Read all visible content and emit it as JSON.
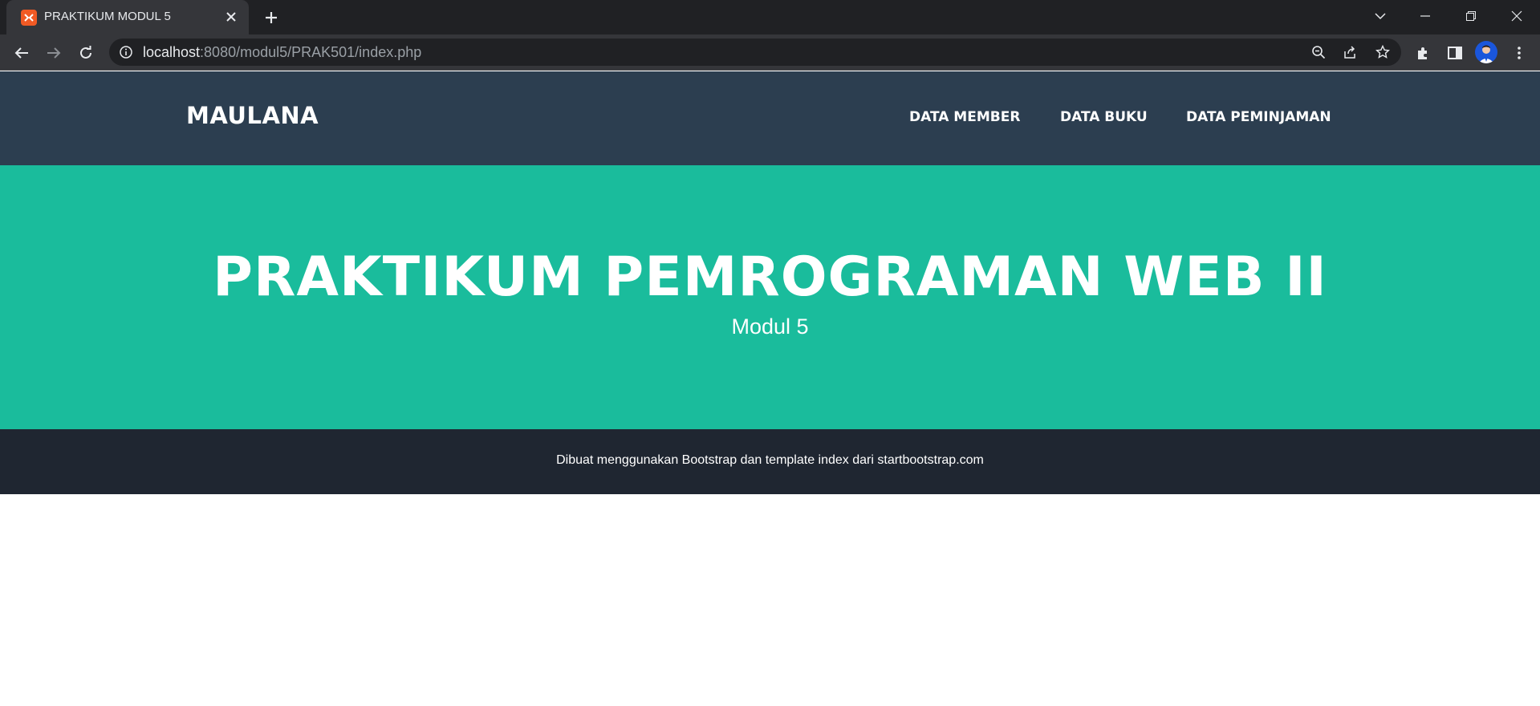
{
  "browser": {
    "tab_title": "PRAKTIKUM MODUL 5",
    "url_host": "localhost",
    "url_path": ":8080/modul5/PRAK501/index.php"
  },
  "navbar": {
    "brand": "MAULANA",
    "links": [
      "DATA MEMBER",
      "DATA BUKU",
      "DATA PEMINJAMAN"
    ]
  },
  "hero": {
    "title": "PRAKTIKUM PEMROGRAMAN WEB II",
    "subtitle": "Modul 5"
  },
  "footer": {
    "text": "Dibuat menggunakan Bootstrap dan template index dari startbootstrap.com"
  },
  "colors": {
    "navbar_bg": "#2c3e50",
    "hero_bg": "#1abc9c",
    "footer_bg": "#1f2631",
    "chrome_dark": "#202124",
    "chrome_tab": "#35363a"
  },
  "icons": [
    "xampp-favicon-icon",
    "close-icon",
    "plus-icon",
    "chevron-down-icon",
    "minimize-icon",
    "restore-icon",
    "window-close-icon",
    "back-arrow-icon",
    "forward-arrow-icon",
    "reload-icon",
    "info-icon",
    "zoom-out-icon",
    "share-icon",
    "star-icon",
    "extensions-icon",
    "side-panel-icon",
    "profile-avatar-icon",
    "kebab-menu-icon"
  ]
}
